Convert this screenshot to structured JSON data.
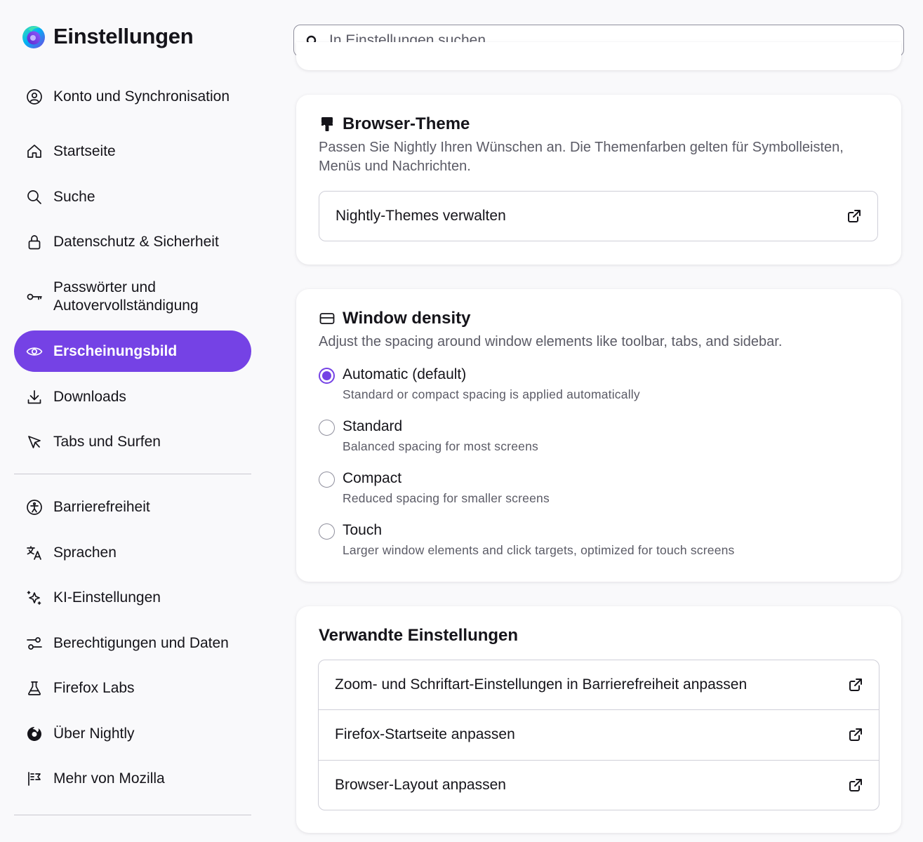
{
  "app": {
    "title": "Einstellungen"
  },
  "search": {
    "placeholder": "In Einstellungen suchen",
    "value": ""
  },
  "sidebar": {
    "items": [
      {
        "id": "account",
        "label": "Konto und Synchronisation",
        "icon": "account-icon"
      },
      {
        "id": "home",
        "label": "Startseite",
        "icon": "home-icon"
      },
      {
        "id": "search",
        "label": "Suche",
        "icon": "search-icon"
      },
      {
        "id": "privacy",
        "label": "Datenschutz & Sicherheit",
        "icon": "lock-icon"
      },
      {
        "id": "passwords",
        "label": "Passwörter und Autovervollständigung",
        "icon": "key-icon"
      },
      {
        "id": "appearance",
        "label": "Erscheinungsbild",
        "icon": "eye-icon",
        "active": true
      },
      {
        "id": "downloads",
        "label": "Downloads",
        "icon": "download-icon"
      },
      {
        "id": "tabs",
        "label": "Tabs und Surfen",
        "icon": "cursor-icon"
      },
      {
        "id": "accessibility",
        "label": "Barrierefreiheit",
        "icon": "accessibility-icon"
      },
      {
        "id": "languages",
        "label": "Sprachen",
        "icon": "translate-icon"
      },
      {
        "id": "ai",
        "label": "KI-Einstellungen",
        "icon": "sparkle-icon"
      },
      {
        "id": "permissions",
        "label": "Berechtigungen und Daten",
        "icon": "permissions-icon"
      },
      {
        "id": "labs",
        "label": "Firefox Labs",
        "icon": "flask-icon"
      },
      {
        "id": "about",
        "label": "Über Nightly",
        "icon": "nightly-icon"
      },
      {
        "id": "mozilla",
        "label": "Mehr von Mozilla",
        "icon": "mozilla-icon"
      }
    ]
  },
  "theme": {
    "title": "Browser-Theme",
    "icon": "paintbrush-icon",
    "description": "Passen Sie Nightly Ihren Wünschen an. Die Themenfarben gelten für Symbolleisten, Menüs und Nachrichten.",
    "manage_label": "Nightly-Themes verwalten"
  },
  "density": {
    "title": "Window density",
    "icon": "window-icon",
    "description": "Adjust the spacing around window elements like toolbar, tabs, and sidebar.",
    "options": [
      {
        "label": "Automatic (default)",
        "desc": "Standard or compact spacing is applied automatically",
        "checked": true
      },
      {
        "label": "Standard",
        "desc": "Balanced spacing for most screens",
        "checked": false
      },
      {
        "label": "Compact",
        "desc": "Reduced spacing for smaller screens",
        "checked": false
      },
      {
        "label": "Touch",
        "desc": "Larger window elements and click targets, optimized for touch screens",
        "checked": false
      }
    ]
  },
  "related": {
    "title": "Verwandte Einstellungen",
    "items": [
      {
        "label": "Zoom- und Schriftart-Einstellungen in Barrierefreiheit anpassen"
      },
      {
        "label": "Firefox-Startseite anpassen"
      },
      {
        "label": "Browser-Layout anpassen"
      }
    ]
  },
  "colors": {
    "accent": "#7542e5",
    "text": "#15141a",
    "muted": "#5b5b66",
    "border": "#cfcfd8",
    "background": "#f9f9fb"
  }
}
